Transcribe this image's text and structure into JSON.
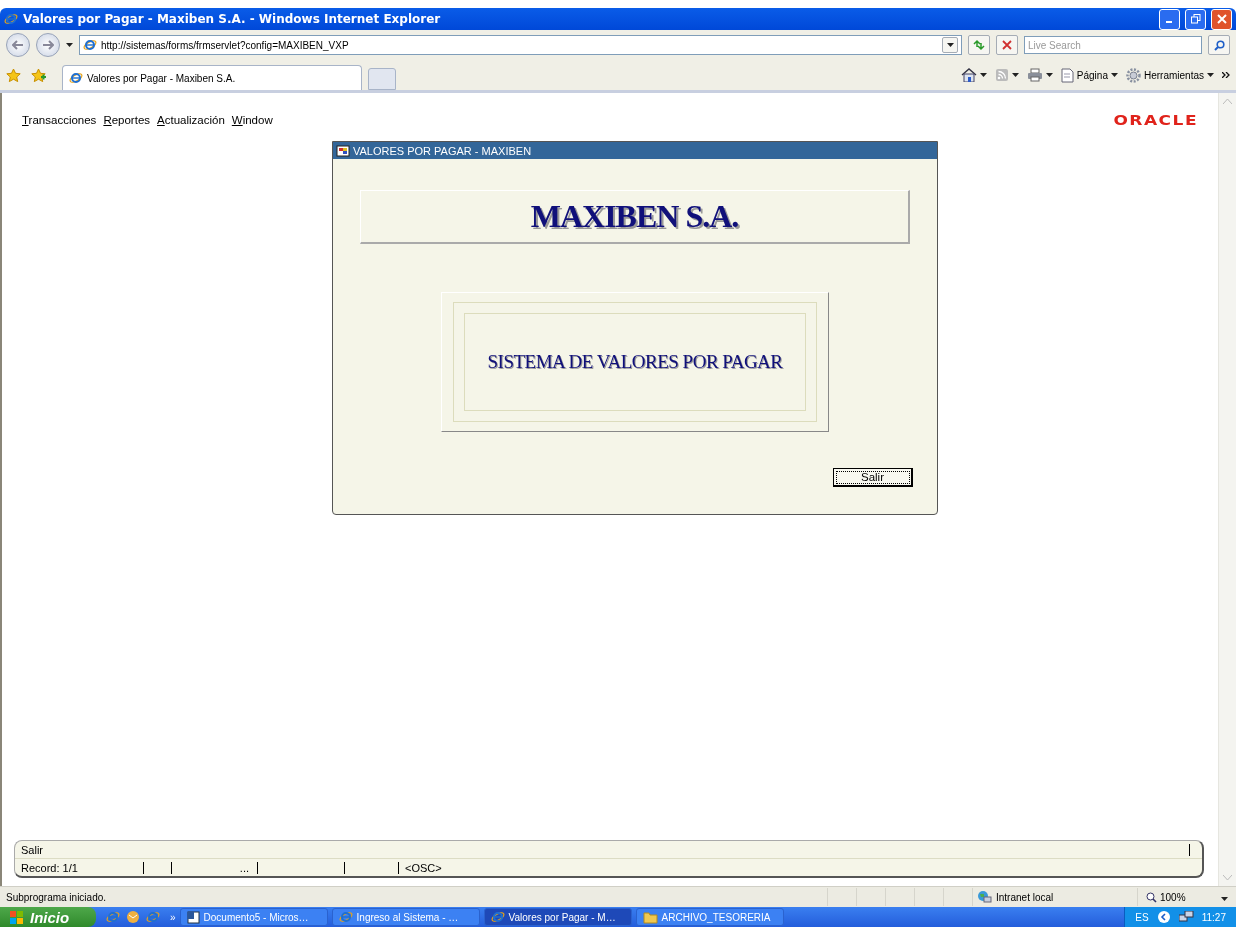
{
  "window": {
    "title": "Valores por Pagar - Maxiben S.A. - Windows Internet Explorer"
  },
  "address_bar": {
    "url": "http://sistemas/forms/frmservlet?config=MAXIBEN_VXP",
    "search_placeholder": "Live Search"
  },
  "tabs": [
    {
      "label": "Valores por Pagar - Maxiben S.A.",
      "selected": true
    }
  ],
  "command_bar": [
    {
      "kind": "home"
    },
    {
      "kind": "feeds"
    },
    {
      "kind": "print"
    },
    {
      "kind": "page",
      "label": "Página"
    },
    {
      "kind": "tools",
      "label": "Herramientas"
    }
  ],
  "app": {
    "menu": [
      {
        "label": "Transacciones"
      },
      {
        "label": "Reportes"
      },
      {
        "label": "Actualización"
      },
      {
        "label": "Window"
      }
    ],
    "logo": "ORACLE",
    "form": {
      "title": "VALORES POR PAGAR - MAXIBEN",
      "company": "MAXIBEN S.A.",
      "system": "SISTEMA DE VALORES POR PAGAR",
      "button": "Salir"
    },
    "status": {
      "message": "Salir",
      "record": "Record: 1/1",
      "field_3": "...",
      "mode": "<OSC>"
    }
  },
  "status_bar": {
    "message": "Subprograma iniciado.",
    "zone": "Intranet local",
    "zoom": "100%"
  },
  "taskbar": {
    "start": "Inicio",
    "overflow": "»",
    "tasks": [
      {
        "label": "Documento5 - Micros…",
        "kind": "word",
        "selected": false
      },
      {
        "label": "Ingreso al Sistema - …",
        "kind": "ie",
        "selected": false
      },
      {
        "label": "Valores por Pagar - M…",
        "kind": "ie",
        "selected": true
      },
      {
        "label": "ARCHIVO_TESORERIA",
        "kind": "folder",
        "selected": false
      }
    ],
    "language": "ES",
    "clock": "11:27"
  }
}
